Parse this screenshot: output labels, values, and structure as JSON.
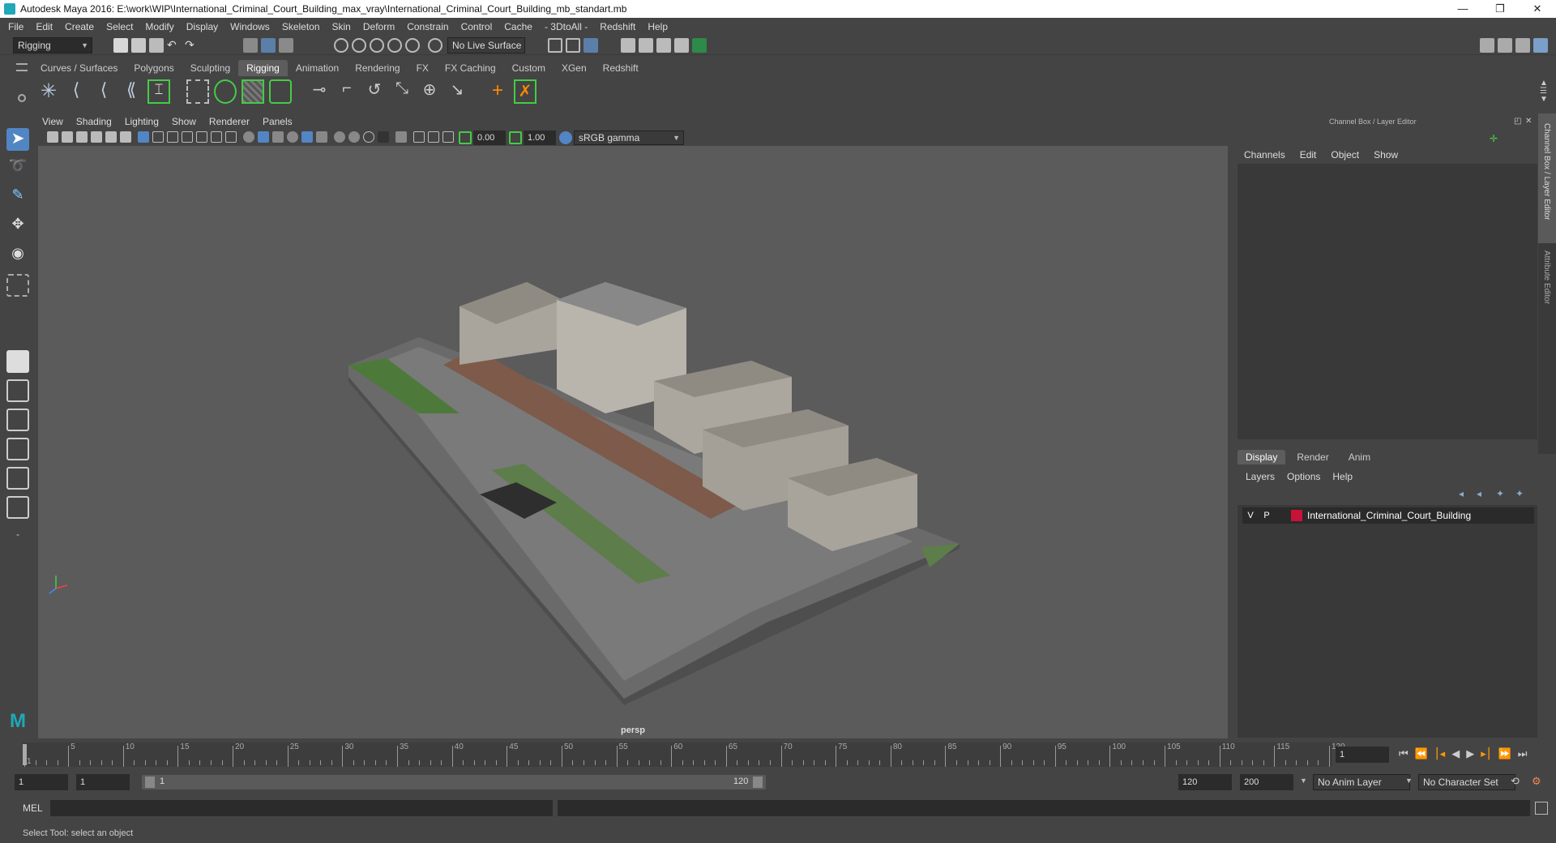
{
  "window": {
    "title": "Autodesk Maya 2016: E:\\work\\WIP\\International_Criminal_Court_Building_max_vray\\International_Criminal_Court_Building_mb_standart.mb",
    "minimize": "—",
    "restore": "❐",
    "close": "✕"
  },
  "menubar": [
    "File",
    "Edit",
    "Create",
    "Select",
    "Modify",
    "Display",
    "Windows",
    "Skeleton",
    "Skin",
    "Deform",
    "Constrain",
    "Control",
    "Cache",
    "- 3DtoAll -",
    "Redshift",
    "Help"
  ],
  "status_line": {
    "menu_set": "Rigging",
    "live_surface": "No Live Surface"
  },
  "shelf_tabs": [
    {
      "label": "Curves / Surfaces",
      "active": false
    },
    {
      "label": "Polygons",
      "active": false
    },
    {
      "label": "Sculpting",
      "active": false
    },
    {
      "label": "Rigging",
      "active": true
    },
    {
      "label": "Animation",
      "active": false
    },
    {
      "label": "Rendering",
      "active": false
    },
    {
      "label": "FX",
      "active": false
    },
    {
      "label": "FX Caching",
      "active": false
    },
    {
      "label": "Custom",
      "active": false
    },
    {
      "label": "XGen",
      "active": false
    },
    {
      "label": "Redshift",
      "active": false
    }
  ],
  "viewport": {
    "menu": [
      "View",
      "Shading",
      "Lighting",
      "Show",
      "Renderer",
      "Panels"
    ],
    "exposure": "0.00",
    "gamma": "1.00",
    "color_space": "sRGB gamma",
    "camera": "persp"
  },
  "channel_box": {
    "title": "Channel Box / Layer Editor",
    "menu": [
      "Channels",
      "Edit",
      "Object",
      "Show"
    ]
  },
  "layer_editor": {
    "tabs": [
      {
        "label": "Display",
        "active": true
      },
      {
        "label": "Render",
        "active": false
      },
      {
        "label": "Anim",
        "active": false
      }
    ],
    "menu": [
      "Layers",
      "Options",
      "Help"
    ],
    "layer": {
      "visible": "V",
      "playback": "P",
      "color": "#c8123a",
      "name": "International_Criminal_Court_Building"
    }
  },
  "side_tabs": [
    "Channel Box / Layer Editor",
    "Attribute Editor"
  ],
  "time_slider": {
    "ticks": [
      1,
      5,
      10,
      15,
      20,
      25,
      30,
      35,
      40,
      45,
      50,
      55,
      60,
      65,
      70,
      75,
      80,
      85,
      90,
      95,
      100,
      105,
      110,
      115,
      120
    ],
    "current_frame": "1"
  },
  "range_slider": {
    "start": "1",
    "playback_start": "1",
    "range_start_label": "1",
    "range_end_label": "120",
    "playback_end": "120",
    "end": "200",
    "anim_layer": "No Anim Layer",
    "character_set": "No Character Set"
  },
  "command_line": {
    "label": "MEL"
  },
  "help_line": {
    "text": "Select Tool: select an object"
  }
}
